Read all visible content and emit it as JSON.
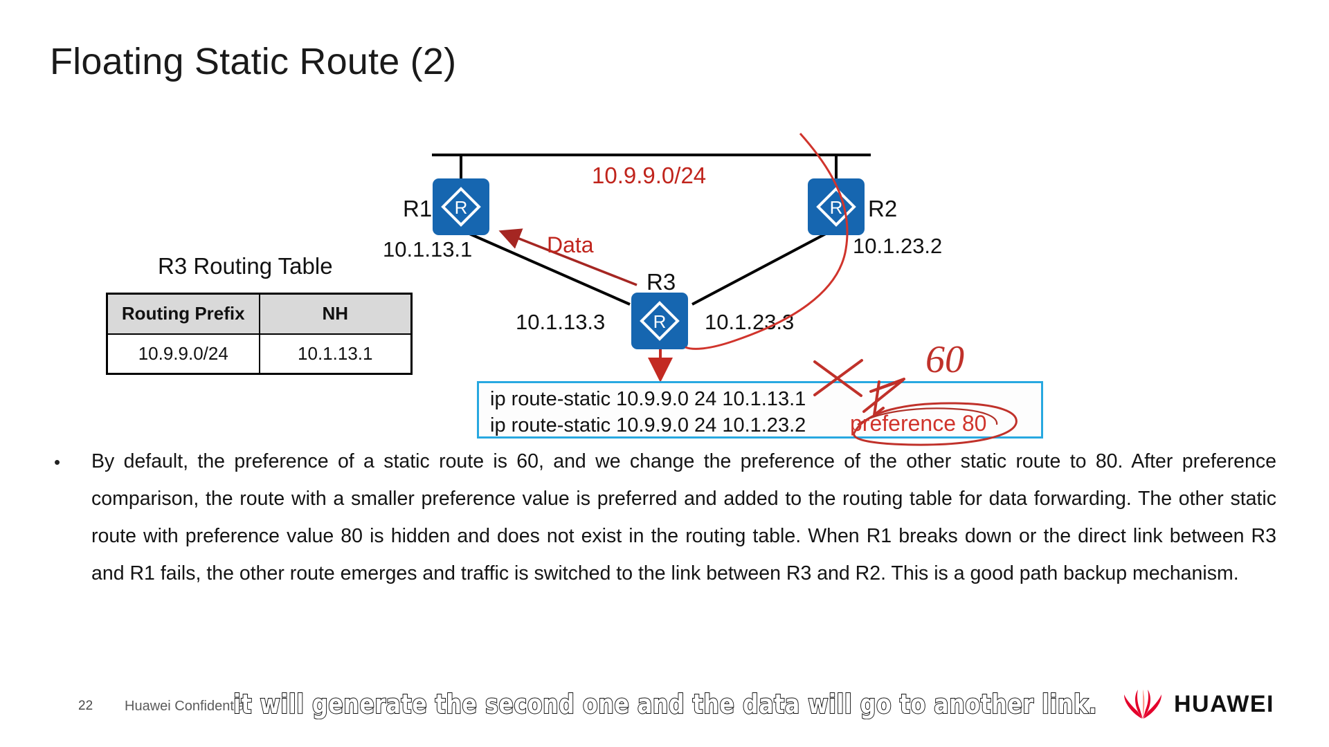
{
  "slide": {
    "title": "Floating Static Route (2)"
  },
  "diagram": {
    "link_label": "10.9.9.0/24",
    "data_label": "Data",
    "routers": [
      {
        "name": "R1",
        "icon": "router-icon"
      },
      {
        "name": "R2",
        "icon": "router-icon"
      },
      {
        "name": "R3",
        "icon": "router-icon"
      }
    ],
    "interfaces": {
      "r1_ip": "10.1.13.1",
      "r2_ip": "10.1.23.2",
      "r3_left_ip": "10.1.13.3",
      "r3_right_ip": "10.1.23.3"
    }
  },
  "routing_table": {
    "title": "R3 Routing Table",
    "headers": [
      "Routing Prefix",
      "NH"
    ],
    "rows": [
      [
        "10.9.9.0/24",
        "10.1.13.1"
      ]
    ]
  },
  "command_box": {
    "lines": [
      "ip route-static 10.9.9.0 24 10.1.13.1",
      "ip route-static 10.9.9.0 24 10.1.23.2"
    ]
  },
  "annotations": {
    "preference_80": "preference 80",
    "handwritten_60": "60",
    "marks": [
      "cross-out-mark",
      "arrow-to-60",
      "ellipse-around-preference-80",
      "curve-from-r2-to-r3"
    ]
  },
  "body": {
    "bullet": "•",
    "paragraph": "By default, the preference of a static route is 60, and we change the preference of the other static route to 80. After preference comparison, the route with a smaller preference value is preferred and added to the routing table for data forwarding. The other static route with preference value 80 is hidden and does not exist in the routing table. When R1 breaks down or the direct link between R3 and R1 fails, the other route emerges and traffic is switched to the link between R3 and R2. This is a good path backup mechanism."
  },
  "footer": {
    "page_number": "22",
    "confidential": "Huawei Confidential",
    "subtitle_overlay": "it will generate the second one and the data will go to another link.",
    "brand": "HUAWEI"
  },
  "colors": {
    "router_blue": "#1666b0",
    "annotation_red": "#d0342c",
    "link_label_red": "#c0241c",
    "command_border_cyan": "#27a8e0",
    "table_header_gray": "#d9d9d9",
    "huawei_red": "#e4002b"
  }
}
